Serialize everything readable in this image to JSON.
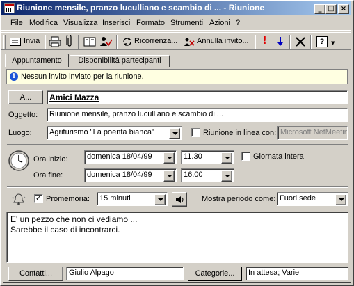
{
  "window": {
    "title": "Riunione mensile, pranzo luculliano e scambio di ... - Riunione",
    "buttons": {
      "minimize": "_",
      "maximize": "□",
      "close": "×"
    }
  },
  "menubar": [
    "File",
    "Modifica",
    "Visualizza",
    "Inserisci",
    "Formato",
    "Strumenti",
    "Azioni",
    "?"
  ],
  "toolbar": {
    "send_label": "Invia",
    "recurrence_label": "Ricorrenza...",
    "cancel_invite_label": "Annulla invito...",
    "help_label": "?"
  },
  "tabs": [
    "Appuntamento",
    "Disponibilità partecipanti"
  ],
  "info": "Nessun invito inviato per la riunione.",
  "form": {
    "to_button": "A...",
    "to_value": "Amici Mazza",
    "subject_label": "Oggetto:",
    "subject_value": "Riunione mensile, pranzo luculliano e scambio di ...",
    "location_label": "Luogo:",
    "location_value": "Agriturismo \"La poenta bianca\"",
    "online_label": "Riunione in linea con:",
    "online_value": "Microsoft NetMeeting",
    "start_label": "Ora inizio:",
    "start_date": "domenica 18/04/99",
    "start_time": "11.30",
    "allday_label": "Giornata intera",
    "end_label": "Ora fine:",
    "end_date": "domenica 18/04/99",
    "end_time": "16.00",
    "reminder_label": "Promemoria:",
    "reminder_value": "15 minuti",
    "showtime_label": "Mostra periodo come:",
    "showtime_value": "Fuori sede",
    "notes": "E' un pezzo che non ci vediamo ...\nSarebbe il caso di incontrarci.",
    "contacts_button": "Contatti...",
    "contacts_value": "Giulio Alpago",
    "categories_button": "Categorie...",
    "categories_value": "In attesa; Varie"
  },
  "colors": {
    "title_start": "#0a246a",
    "title_end": "#a6caf0",
    "info_bg": "#ffffe1",
    "face": "#d4d0c8"
  }
}
